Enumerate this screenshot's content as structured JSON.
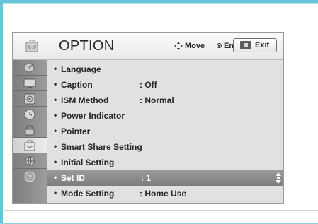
{
  "header": {
    "title": "OPTION",
    "move_label": "Move",
    "enter_label": "Enter",
    "exit_label": "Exit"
  },
  "sidebar_tabs": [
    {
      "icon": "satellite-dish-icon"
    },
    {
      "icon": "tv-screen-icon"
    },
    {
      "icon": "speaker-icon"
    },
    {
      "icon": "clock-icon"
    },
    {
      "icon": "lock-icon"
    },
    {
      "icon": "option-briefcase-icon",
      "active": true
    },
    {
      "icon": "network-icon"
    },
    {
      "icon": "help-icon"
    }
  ],
  "menu": {
    "bullet": "•",
    "items": [
      {
        "label": "Language",
        "value": ""
      },
      {
        "label": "Caption",
        "value": ": Off"
      },
      {
        "label": "ISM Method",
        "value": ": Normal"
      },
      {
        "label": "Power Indicator",
        "value": ""
      },
      {
        "label": "Pointer",
        "value": ""
      },
      {
        "label": "Smart Share Setting",
        "value": ""
      },
      {
        "label": "Initial Setting",
        "value": ""
      },
      {
        "label": "Set ID",
        "value": ": 1",
        "selected": true
      },
      {
        "label": "Mode Setting",
        "value": ": Home Use"
      }
    ]
  },
  "colors": {
    "frame": "#66c5d6",
    "panel_bg": "#e1e1e1",
    "sidebar_bg": "#8c8c8c",
    "selected_row": "#8a8a8a"
  }
}
